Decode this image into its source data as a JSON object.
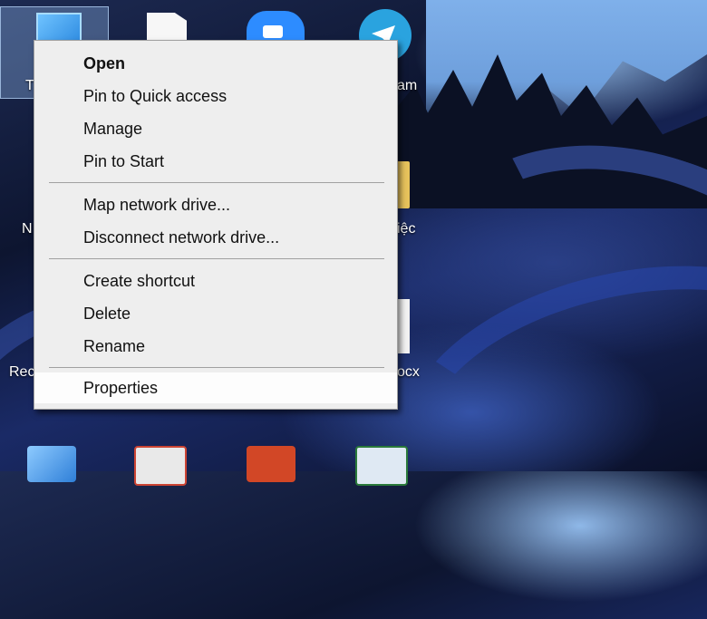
{
  "desktop": {
    "icons": {
      "this_pc_label": "T",
      "telegram_label": "am",
      "network_label": "N",
      "folder_label": "iệc",
      "recycle_label": "Rec",
      "docx_label": "ocx"
    }
  },
  "context_menu": {
    "group1": [
      "Open",
      "Pin to Quick access",
      "Manage",
      "Pin to Start"
    ],
    "group2": [
      "Map network drive...",
      "Disconnect network drive..."
    ],
    "group3": [
      "Create shortcut",
      "Delete",
      "Rename"
    ],
    "group4": [
      "Properties"
    ],
    "default_item": "Open",
    "hovered_item": "Properties"
  },
  "colors": {
    "menu_bg": "#eeeeee",
    "menu_hover": "#fdfdfd",
    "separator": "#a0a0a0"
  }
}
